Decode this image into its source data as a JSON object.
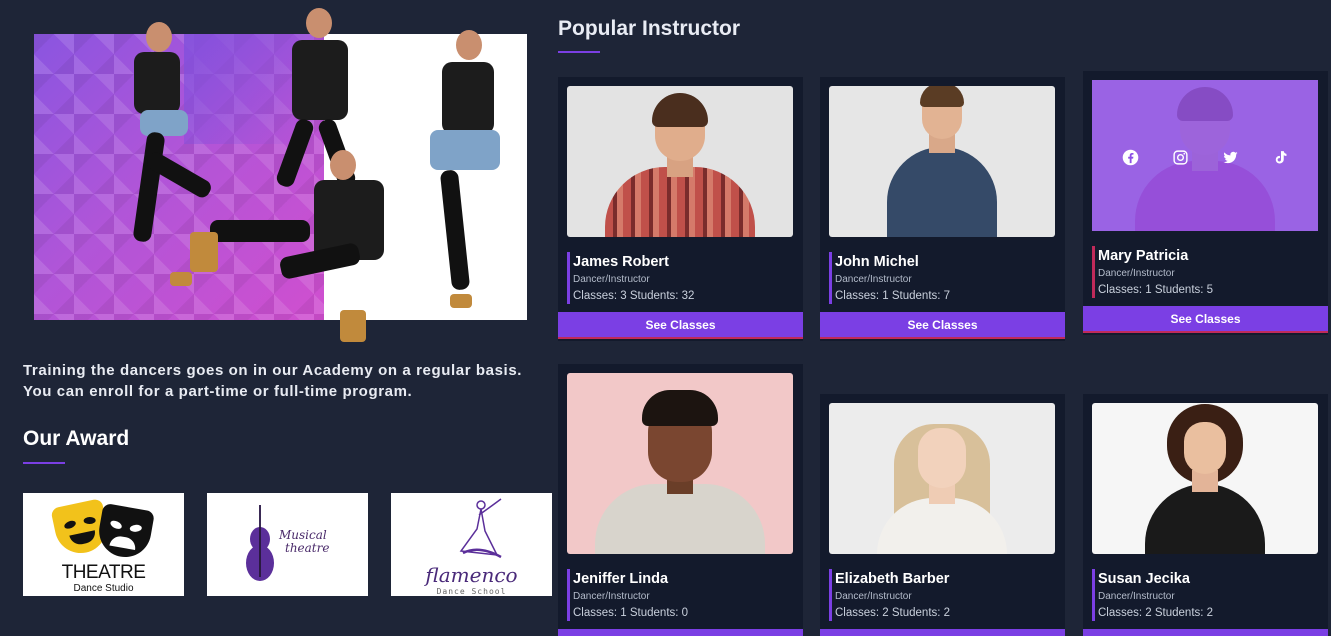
{
  "intro_text": "Training the dancers goes on in our Academy on a regular basis. You can enroll for a part-time or full-time program.",
  "awards": {
    "title": "Our Award",
    "items": [
      {
        "icon": "theatre-masks-icon",
        "title": "THEATRE",
        "subtitle": "Dance Studio"
      },
      {
        "icon": "cello-icon",
        "title": "Musical",
        "subtitle": "theatre"
      },
      {
        "icon": "flamenco-dancer-icon",
        "title": "flamenco",
        "subtitle": "Dance School"
      }
    ]
  },
  "instructors": {
    "title": "Popular Instructor",
    "button_label": "See Classes",
    "cards": [
      {
        "name": "James Robert",
        "role": "Dancer/Instructor",
        "stats": "Classes: 3 Students: 32"
      },
      {
        "name": "John Michel",
        "role": "Dancer/Instructor",
        "stats": "Classes: 1 Students: 7"
      },
      {
        "name": "Mary Patricia",
        "role": "Dancer/Instructor",
        "stats": "Classes: 1 Students: 5"
      },
      {
        "name": "Jeniffer Linda",
        "role": "Dancer/Instructor",
        "stats": "Classes: 1 Students: 0"
      },
      {
        "name": "Elizabeth Barber",
        "role": "Dancer/Instructor",
        "stats": "Classes: 2 Students: 2"
      },
      {
        "name": "Susan Jecika",
        "role": "Dancer/Instructor",
        "stats": "Classes: 2 Students: 2"
      }
    ],
    "social_icons": [
      "facebook-icon",
      "instagram-icon",
      "twitter-icon",
      "tiktok-icon"
    ]
  },
  "colors": {
    "background": "#1e2537",
    "card": "#131a2c",
    "accent": "#7b3fe4"
  }
}
